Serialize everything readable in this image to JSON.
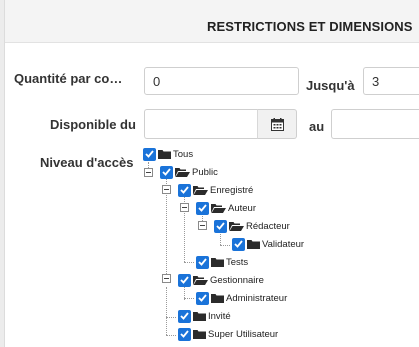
{
  "section": {
    "title": "RESTRICTIONS ET DIMENSIONS"
  },
  "quantity": {
    "label": "Quantité par co…",
    "value": "0"
  },
  "upto": {
    "label": "Jusqu'à",
    "value": "3"
  },
  "available": {
    "label": "Disponible du",
    "from_value": "",
    "to_label": "au",
    "to_value": ""
  },
  "access": {
    "label": "Niveau d'accès",
    "nodes": [
      {
        "label": "Tous",
        "checked": true,
        "folder": "closed"
      },
      {
        "label": "Public",
        "checked": true,
        "folder": "open"
      },
      {
        "label": "Enregistré",
        "checked": true,
        "folder": "open"
      },
      {
        "label": "Auteur",
        "checked": true,
        "folder": "open"
      },
      {
        "label": "Rédacteur",
        "checked": true,
        "folder": "open"
      },
      {
        "label": "Validateur",
        "checked": true,
        "folder": "closed"
      },
      {
        "label": "Tests",
        "checked": true,
        "folder": "closed"
      },
      {
        "label": "Gestionnaire",
        "checked": true,
        "folder": "open"
      },
      {
        "label": "Administrateur",
        "checked": true,
        "folder": "closed"
      },
      {
        "label": "Invité",
        "checked": true,
        "folder": "closed"
      },
      {
        "label": "Super Utilisateur",
        "checked": true,
        "folder": "closed"
      }
    ]
  },
  "colors": {
    "checkbox": "#1a73d9",
    "folder": "#2b2b2b"
  }
}
